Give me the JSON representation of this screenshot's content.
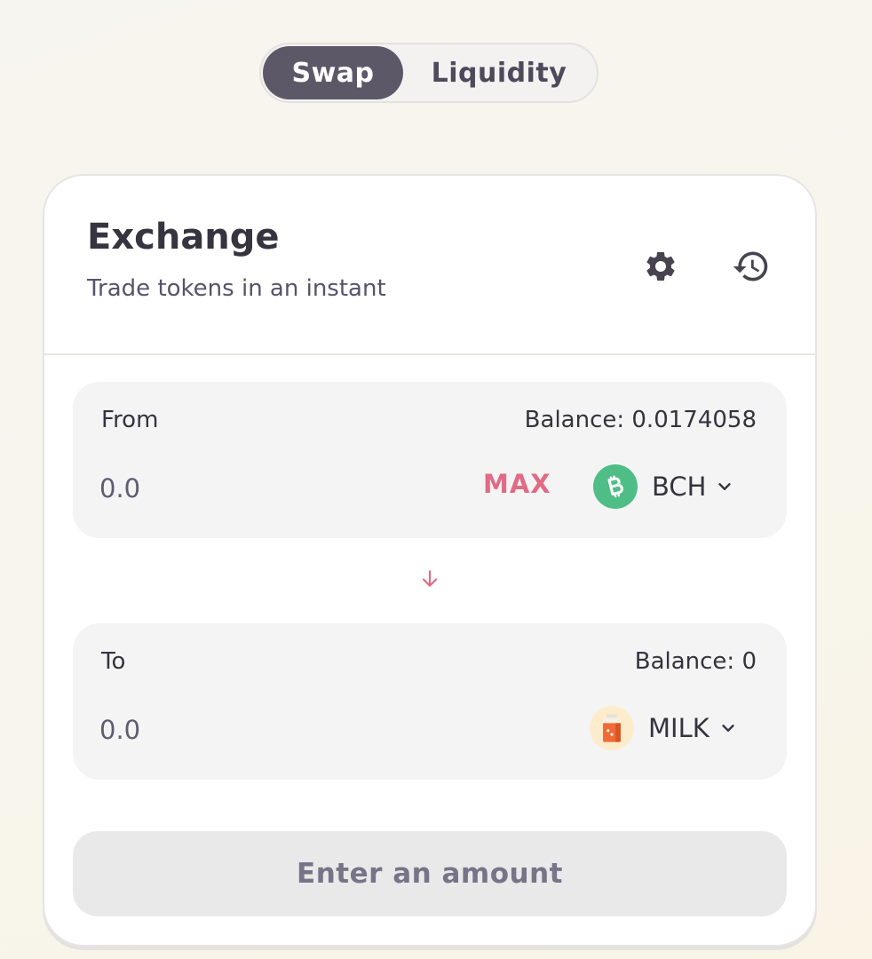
{
  "tabs": [
    {
      "label": "Swap",
      "active": true
    },
    {
      "label": "Liquidity",
      "active": false
    }
  ],
  "header": {
    "title": "Exchange",
    "subtitle": "Trade tokens in an instant",
    "settings_icon": "gear-icon",
    "history_icon": "history-icon"
  },
  "from": {
    "label": "From",
    "balance": "Balance: 0.0174058",
    "amount_placeholder": "0.0",
    "max_label": "MAX",
    "token": {
      "symbol": "BCH",
      "icon": "bch-token-icon",
      "color": "#4fbd86"
    }
  },
  "to": {
    "label": "To",
    "balance": "Balance: 0",
    "amount_placeholder": "0.0",
    "token": {
      "symbol": "MILK",
      "icon": "milk-token-icon",
      "color": "#f06a36"
    }
  },
  "swap_arrow_icon": "arrow-down-icon",
  "action_button": {
    "label": "Enter an amount"
  },
  "colors": {
    "accent": "#e06b86",
    "active_tab": "#5d5868",
    "panel_bg": "#f4f4f4",
    "text_dark": "#36343f"
  }
}
